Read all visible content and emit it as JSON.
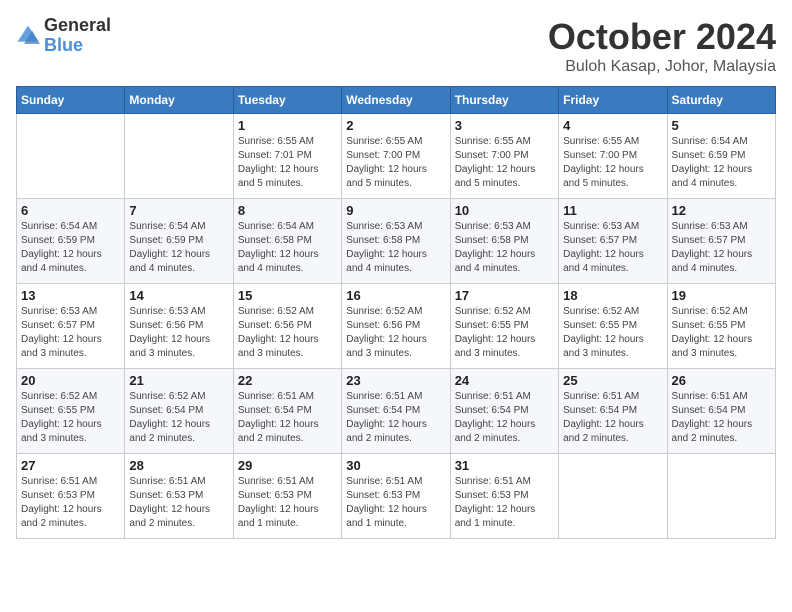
{
  "logo": {
    "text_general": "General",
    "text_blue": "Blue"
  },
  "title": "October 2024",
  "location": "Buloh Kasap, Johor, Malaysia",
  "days_of_week": [
    "Sunday",
    "Monday",
    "Tuesday",
    "Wednesday",
    "Thursday",
    "Friday",
    "Saturday"
  ],
  "weeks": [
    [
      {
        "day": "",
        "info": ""
      },
      {
        "day": "",
        "info": ""
      },
      {
        "day": "1",
        "info": "Sunrise: 6:55 AM\nSunset: 7:01 PM\nDaylight: 12 hours\nand 5 minutes."
      },
      {
        "day": "2",
        "info": "Sunrise: 6:55 AM\nSunset: 7:00 PM\nDaylight: 12 hours\nand 5 minutes."
      },
      {
        "day": "3",
        "info": "Sunrise: 6:55 AM\nSunset: 7:00 PM\nDaylight: 12 hours\nand 5 minutes."
      },
      {
        "day": "4",
        "info": "Sunrise: 6:55 AM\nSunset: 7:00 PM\nDaylight: 12 hours\nand 5 minutes."
      },
      {
        "day": "5",
        "info": "Sunrise: 6:54 AM\nSunset: 6:59 PM\nDaylight: 12 hours\nand 4 minutes."
      }
    ],
    [
      {
        "day": "6",
        "info": "Sunrise: 6:54 AM\nSunset: 6:59 PM\nDaylight: 12 hours\nand 4 minutes."
      },
      {
        "day": "7",
        "info": "Sunrise: 6:54 AM\nSunset: 6:59 PM\nDaylight: 12 hours\nand 4 minutes."
      },
      {
        "day": "8",
        "info": "Sunrise: 6:54 AM\nSunset: 6:58 PM\nDaylight: 12 hours\nand 4 minutes."
      },
      {
        "day": "9",
        "info": "Sunrise: 6:53 AM\nSunset: 6:58 PM\nDaylight: 12 hours\nand 4 minutes."
      },
      {
        "day": "10",
        "info": "Sunrise: 6:53 AM\nSunset: 6:58 PM\nDaylight: 12 hours\nand 4 minutes."
      },
      {
        "day": "11",
        "info": "Sunrise: 6:53 AM\nSunset: 6:57 PM\nDaylight: 12 hours\nand 4 minutes."
      },
      {
        "day": "12",
        "info": "Sunrise: 6:53 AM\nSunset: 6:57 PM\nDaylight: 12 hours\nand 4 minutes."
      }
    ],
    [
      {
        "day": "13",
        "info": "Sunrise: 6:53 AM\nSunset: 6:57 PM\nDaylight: 12 hours\nand 3 minutes."
      },
      {
        "day": "14",
        "info": "Sunrise: 6:53 AM\nSunset: 6:56 PM\nDaylight: 12 hours\nand 3 minutes."
      },
      {
        "day": "15",
        "info": "Sunrise: 6:52 AM\nSunset: 6:56 PM\nDaylight: 12 hours\nand 3 minutes."
      },
      {
        "day": "16",
        "info": "Sunrise: 6:52 AM\nSunset: 6:56 PM\nDaylight: 12 hours\nand 3 minutes."
      },
      {
        "day": "17",
        "info": "Sunrise: 6:52 AM\nSunset: 6:55 PM\nDaylight: 12 hours\nand 3 minutes."
      },
      {
        "day": "18",
        "info": "Sunrise: 6:52 AM\nSunset: 6:55 PM\nDaylight: 12 hours\nand 3 minutes."
      },
      {
        "day": "19",
        "info": "Sunrise: 6:52 AM\nSunset: 6:55 PM\nDaylight: 12 hours\nand 3 minutes."
      }
    ],
    [
      {
        "day": "20",
        "info": "Sunrise: 6:52 AM\nSunset: 6:55 PM\nDaylight: 12 hours\nand 3 minutes."
      },
      {
        "day": "21",
        "info": "Sunrise: 6:52 AM\nSunset: 6:54 PM\nDaylight: 12 hours\nand 2 minutes."
      },
      {
        "day": "22",
        "info": "Sunrise: 6:51 AM\nSunset: 6:54 PM\nDaylight: 12 hours\nand 2 minutes."
      },
      {
        "day": "23",
        "info": "Sunrise: 6:51 AM\nSunset: 6:54 PM\nDaylight: 12 hours\nand 2 minutes."
      },
      {
        "day": "24",
        "info": "Sunrise: 6:51 AM\nSunset: 6:54 PM\nDaylight: 12 hours\nand 2 minutes."
      },
      {
        "day": "25",
        "info": "Sunrise: 6:51 AM\nSunset: 6:54 PM\nDaylight: 12 hours\nand 2 minutes."
      },
      {
        "day": "26",
        "info": "Sunrise: 6:51 AM\nSunset: 6:54 PM\nDaylight: 12 hours\nand 2 minutes."
      }
    ],
    [
      {
        "day": "27",
        "info": "Sunrise: 6:51 AM\nSunset: 6:53 PM\nDaylight: 12 hours\nand 2 minutes."
      },
      {
        "day": "28",
        "info": "Sunrise: 6:51 AM\nSunset: 6:53 PM\nDaylight: 12 hours\nand 2 minutes."
      },
      {
        "day": "29",
        "info": "Sunrise: 6:51 AM\nSunset: 6:53 PM\nDaylight: 12 hours\nand 1 minute."
      },
      {
        "day": "30",
        "info": "Sunrise: 6:51 AM\nSunset: 6:53 PM\nDaylight: 12 hours\nand 1 minute."
      },
      {
        "day": "31",
        "info": "Sunrise: 6:51 AM\nSunset: 6:53 PM\nDaylight: 12 hours\nand 1 minute."
      },
      {
        "day": "",
        "info": ""
      },
      {
        "day": "",
        "info": ""
      }
    ]
  ]
}
